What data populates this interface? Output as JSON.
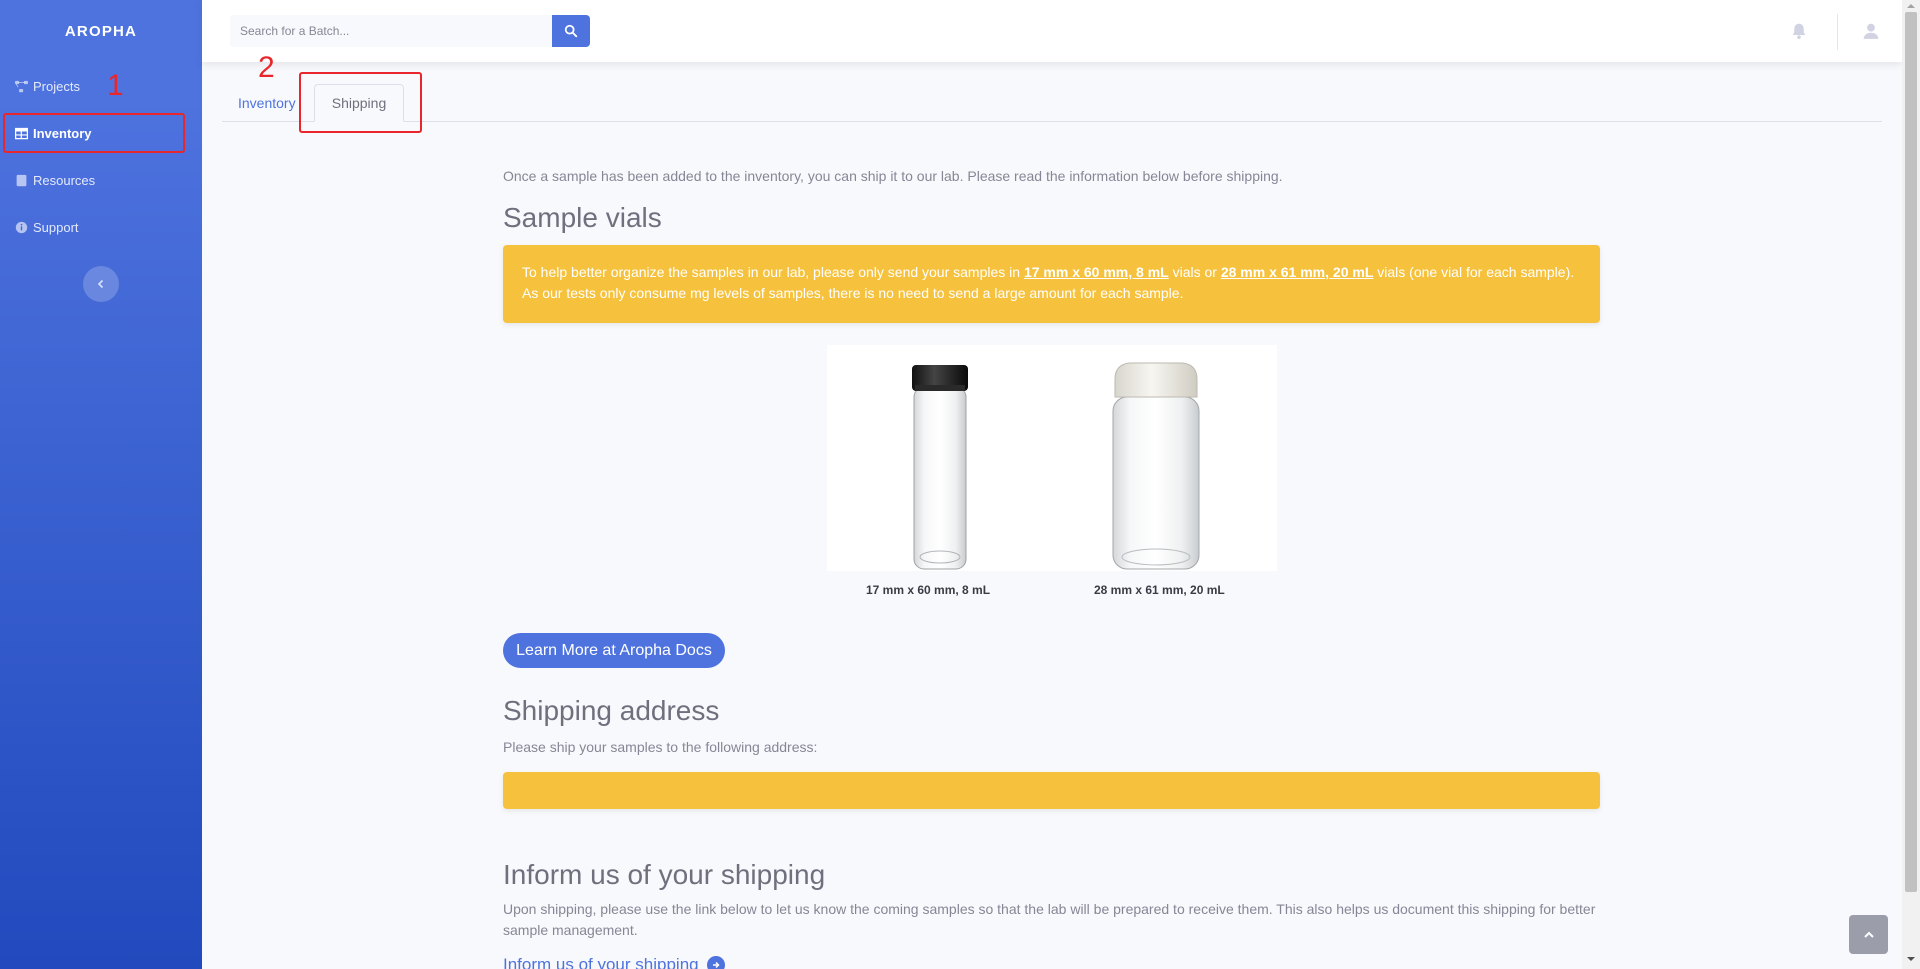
{
  "sidebar": {
    "brand": "AROPHA",
    "items": [
      {
        "label": "Projects",
        "icon": "project-diagram-icon"
      },
      {
        "label": "Inventory",
        "icon": "table-icon"
      },
      {
        "label": "Resources",
        "icon": "book-icon"
      },
      {
        "label": "Support",
        "icon": "info-circle-icon"
      }
    ],
    "active": "Inventory"
  },
  "topbar": {
    "search_placeholder": "Search for a Batch..."
  },
  "tabs": [
    {
      "label": "Inventory"
    },
    {
      "label": "Shipping"
    }
  ],
  "annotations": [
    "1",
    "2"
  ],
  "main": {
    "intro": "Once a sample has been added to the inventory, you can ship it to our lab. Please read the information below before shipping.",
    "vials_heading": "Sample vials",
    "alert_pre": "To help better organize the samples in our lab, please only send your samples in ",
    "alert_link1": "17 mm x 60 mm, 8 mL",
    "alert_mid": " vials or ",
    "alert_link2": "28 mm x 61 mm, 20 mL",
    "alert_post": " vials (one vial for each sample). As our tests only consume mg levels of samples, there is no need to send a large amount for each sample.",
    "vial_captions": [
      "17 mm x 60 mm, 8 mL",
      "28 mm x 61 mm, 20 mL"
    ],
    "learn_more_button": "Learn More at Aropha Docs",
    "shipping_heading": "Shipping address",
    "shipping_sub": "Please ship your samples to the following address:",
    "inform_heading": "Inform us of your shipping",
    "inform_sub": "Upon shipping, please use the link below to let us know the coming samples so that the lab will be prepared to receive them. This also helps us document this shipping for better sample management.",
    "inform_link": "Inform us of your shipping"
  },
  "colors": {
    "primary": "#4e73df",
    "warning": "#f6c23e",
    "annotation": "#e8262b"
  }
}
